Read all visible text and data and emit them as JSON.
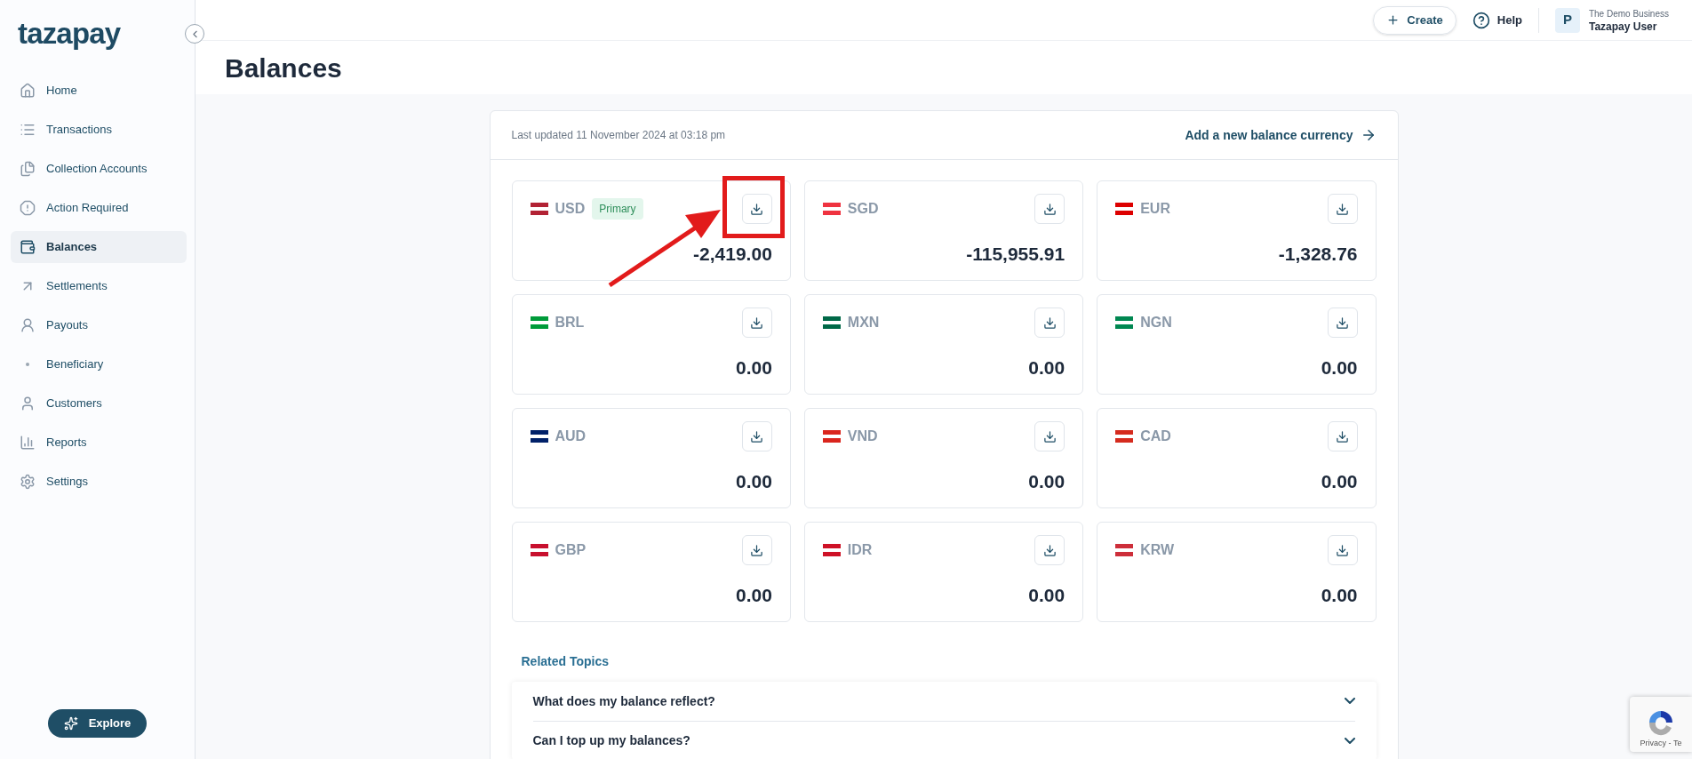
{
  "brand": {
    "logo": "tazapay"
  },
  "sidebar": {
    "items": [
      {
        "label": "Home",
        "selected": false
      },
      {
        "label": "Transactions",
        "selected": false
      },
      {
        "label": "Collection Accounts",
        "selected": false
      },
      {
        "label": "Action Required",
        "selected": false
      },
      {
        "label": "Balances",
        "selected": true
      },
      {
        "label": "Settlements",
        "selected": false
      },
      {
        "label": "Payouts",
        "selected": false,
        "children": [
          {
            "label": "Beneficiary",
            "selected": false
          }
        ]
      },
      {
        "label": "Customers",
        "selected": false
      },
      {
        "label": "Reports",
        "selected": false
      },
      {
        "label": "Settings",
        "selected": false
      }
    ],
    "explore_button": "Explore"
  },
  "topbar": {
    "create_button": "Create",
    "help": "Help",
    "avatar_initial": "P",
    "business": "The Demo Business",
    "user": "Tazapay User"
  },
  "page": {
    "title": "Balances"
  },
  "balances_panel": {
    "last_updated": "Last updated 11 November 2024 at 03:18 pm",
    "add_link": "Add a new balance currency",
    "balances": [
      {
        "currency": "USD",
        "badge": "Primary",
        "amount": "-2,419.00",
        "color": "#b22234",
        "highlighted": true
      },
      {
        "currency": "SGD",
        "amount": "-115,955.91",
        "color": "#ef3340",
        "highlighted": false
      },
      {
        "currency": "EUR",
        "amount": "-1,328.76",
        "color": "#dd0000",
        "highlighted": false
      },
      {
        "currency": "BRL",
        "amount": "0.00",
        "color": "#009b3a",
        "highlighted": false
      },
      {
        "currency": "MXN",
        "amount": "0.00",
        "color": "#006847",
        "highlighted": false
      },
      {
        "currency": "NGN",
        "amount": "0.00",
        "color": "#008751",
        "highlighted": false
      },
      {
        "currency": "AUD",
        "amount": "0.00",
        "color": "#012169",
        "highlighted": false
      },
      {
        "currency": "VND",
        "amount": "0.00",
        "color": "#da251d",
        "highlighted": false
      },
      {
        "currency": "CAD",
        "amount": "0.00",
        "color": "#d52b1e",
        "highlighted": false
      },
      {
        "currency": "GBP",
        "amount": "0.00",
        "color": "#c8102e",
        "highlighted": false
      },
      {
        "currency": "IDR",
        "amount": "0.00",
        "color": "#ce1126",
        "highlighted": false
      },
      {
        "currency": "KRW",
        "amount": "0.00",
        "color": "#cd2e3a",
        "highlighted": false
      }
    ],
    "related_title": "Related Topics",
    "faq": [
      {
        "question": "What does my balance reflect?",
        "expanded": false
      },
      {
        "question": "Can I top up my balances?",
        "expanded": false
      }
    ]
  },
  "recaptcha": {
    "links": "Privacy - Te"
  }
}
